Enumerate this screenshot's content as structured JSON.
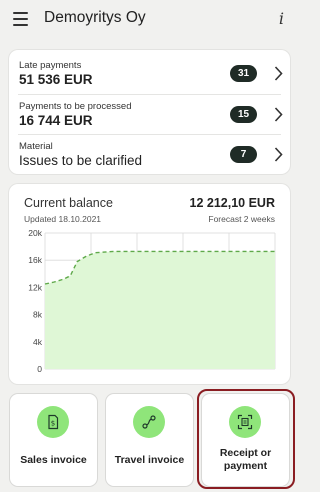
{
  "header": {
    "title": "Demoyritys Oy",
    "info_icon": "info-icon",
    "menu_icon": "hamburger-menu-icon"
  },
  "summary_list": [
    {
      "label": "Late payments",
      "value": "51 536 EUR",
      "count": "31"
    },
    {
      "label": "Payments to be processed",
      "value": "16 744 EUR",
      "count": "15"
    },
    {
      "label": "Material",
      "value": "Issues to be clarified",
      "count": "7"
    }
  ],
  "balance": {
    "title": "Current balance",
    "amount": "12 212,10 EUR",
    "updated": "Updated 18.10.2021",
    "forecast": "Forecast 2 weeks"
  },
  "chart_data": {
    "type": "area",
    "title": "",
    "xlabel": "",
    "ylabel": "",
    "ylim": [
      0,
      20000
    ],
    "yticks": [
      "20k",
      "16k",
      "12k",
      "8k",
      "4k",
      "0"
    ],
    "ytick_values": [
      20000,
      16000,
      12000,
      8000,
      4000,
      0
    ],
    "grid": true,
    "series": [
      {
        "x": [
          0,
          4,
          8,
          11,
          14,
          18,
          22,
          30,
          45,
          60,
          75,
          90,
          100
        ],
        "values": [
          12500,
          12800,
          13200,
          13700,
          15800,
          16600,
          17100,
          17300,
          17300,
          17300,
          17300,
          17300,
          17300
        ]
      }
    ],
    "colors": {
      "fill": "#dff7d6",
      "line": "#5fa94a",
      "grid": "#d9d9d9"
    },
    "line_style": "dashed"
  },
  "actions": [
    {
      "label": "Sales invoice",
      "icon": "sales-invoice-icon"
    },
    {
      "label": "Travel invoice",
      "icon": "route-icon"
    },
    {
      "label": "Receipt or payment",
      "icon": "scan-receipt-icon"
    }
  ],
  "colors": {
    "badge": "#1f2b26",
    "action_icon_bg": "#8fe57a",
    "highlight": "#8a1d22"
  }
}
